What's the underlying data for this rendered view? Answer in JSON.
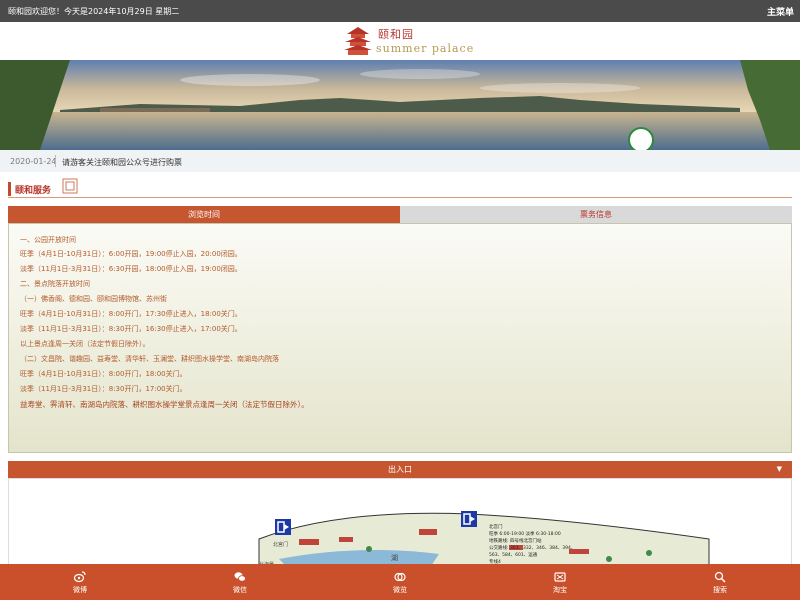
{
  "topbar": {
    "welcome": "颐和园欢迎您！今天是2024年10月29日  星期二",
    "menu_label": "主菜单"
  },
  "logo": {
    "chinese": "颐和园",
    "english": "summer  palace"
  },
  "notice": {
    "date": "2020-01-24",
    "text": "请游客关注颐和园公众号进行购票"
  },
  "section": {
    "title": "颐和服务"
  },
  "tabs": [
    {
      "label": "浏览时间",
      "active": true
    },
    {
      "label": "票务信息",
      "active": false
    }
  ],
  "hours": {
    "lines": [
      "一、公园开放时间",
      "旺季（4月1日-10月31日）：6:00开园，19:00停止入园，20:00闭园。",
      "淡季（11月1日-3月31日）：6:30开园，18:00停止入园，19:00闭园。",
      "二、景点院落开放时间",
      "（一）佛香阁、德和园、颐和园博物馆、苏州街",
      "旺季（4月1日-10月31日）：8:00开门，17:30停止进入，18:00关门。",
      "淡季（11月1日-3月31日）：8:30开门，16:30停止进入，17:00关门。",
      "以上景点逢周一关闭（法定节假日除外）。",
      "（二）文昌院、谐趣园、益寿堂、清华轩、玉澜堂、耕织图水操学堂、南湖岛内院落",
      "旺季（4月1日-10月31日）：8:00开门，18:00关门。",
      "淡季（11月1日-3月31日）：8:30开门，17:00关门。",
      "益寿堂、霁清轩、南湖岛内院落、耕织图水操学堂景点逢周一关闭（法定节假日除外）。"
    ]
  },
  "entrance": {
    "title": "出入口"
  },
  "map": {
    "info_lines": [
      "北宫门",
      "旺季 6:00-19:00    淡季 6:30-18:00",
      "地铁路线: 四号线北宫门站",
      "公交路线: 303、332、346、384、394、",
      "563、584、601、运通",
      "专线4"
    ],
    "label_lake": "湖",
    "label_gate": "北宫门",
    "label_lbl2": "北海景"
  },
  "bottom_nav": [
    {
      "label": "微博",
      "icon": "weibo-icon"
    },
    {
      "label": "微信",
      "icon": "wechat-icon"
    },
    {
      "label": "微览",
      "icon": "browse-icon"
    },
    {
      "label": "淘宝",
      "icon": "taobao-icon"
    },
    {
      "label": "搜索",
      "icon": "search-icon"
    }
  ],
  "colors": {
    "accent": "#c9502b",
    "topbar": "#4b4b4b",
    "tab_inactive": "#d9d9d9",
    "text_red": "#b5342a"
  }
}
